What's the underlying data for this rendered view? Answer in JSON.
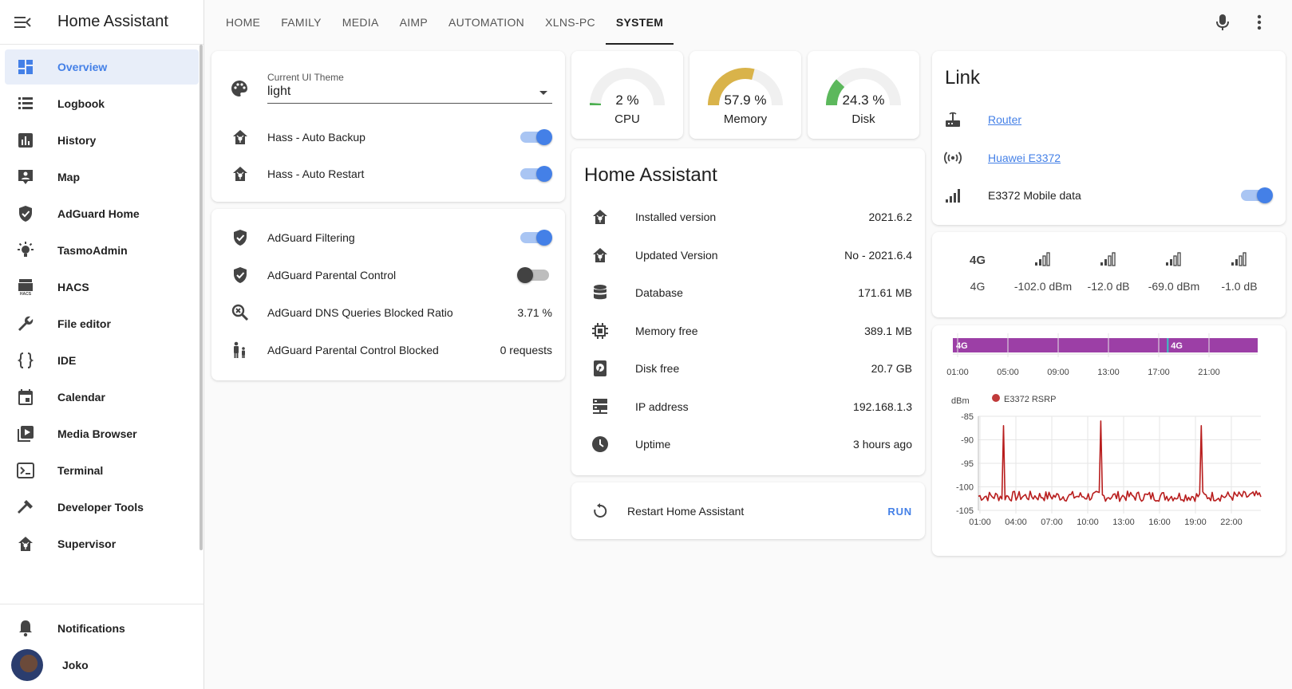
{
  "sidebar": {
    "title": "Home Assistant",
    "items": [
      {
        "label": "Overview",
        "icon": "overview-icon",
        "active": true
      },
      {
        "label": "Logbook",
        "icon": "logbook-icon"
      },
      {
        "label": "History",
        "icon": "history-icon"
      },
      {
        "label": "Map",
        "icon": "map-icon"
      },
      {
        "label": "AdGuard Home",
        "icon": "shield-check-icon"
      },
      {
        "label": "TasmoAdmin",
        "icon": "lightbulb-icon"
      },
      {
        "label": "HACS",
        "icon": "hacs-icon"
      },
      {
        "label": "File editor",
        "icon": "wrench-icon"
      },
      {
        "label": "IDE",
        "icon": "code-braces-icon"
      },
      {
        "label": "Calendar",
        "icon": "calendar-icon"
      },
      {
        "label": "Media Browser",
        "icon": "media-browser-icon"
      },
      {
        "label": "Terminal",
        "icon": "terminal-icon"
      },
      {
        "label": "Developer Tools",
        "icon": "hammer-icon"
      },
      {
        "label": "Supervisor",
        "icon": "supervisor-icon"
      }
    ],
    "notifications_label": "Notifications",
    "user_name": "Joko"
  },
  "topbar": {
    "tabs": [
      "HOME",
      "FAMILY",
      "MEDIA",
      "AIMP",
      "AUTOMATION",
      "XLNS-PC",
      "SYSTEM"
    ],
    "active_tab": "SYSTEM"
  },
  "theme_card": {
    "select_label": "Current UI Theme",
    "select_value": "light",
    "rows": [
      {
        "label": "Hass - Auto Backup",
        "on": true
      },
      {
        "label": "Hass - Auto Restart",
        "on": true
      }
    ]
  },
  "adguard_card": {
    "rows": [
      {
        "label": "AdGuard Filtering",
        "type": "toggle",
        "on": true
      },
      {
        "label": "AdGuard Parental Control",
        "type": "toggle",
        "on": false
      },
      {
        "label": "AdGuard DNS Queries Blocked Ratio",
        "value": "3.71 %"
      },
      {
        "label": "AdGuard Parental Control Blocked",
        "value": "0 requests"
      }
    ]
  },
  "gauges": [
    {
      "name": "CPU",
      "value": "2 %",
      "fraction": 0.02,
      "color": "#4caf50"
    },
    {
      "name": "Memory",
      "value": "57.9 %",
      "fraction": 0.579,
      "color": "#d9b34a"
    },
    {
      "name": "Disk",
      "value": "24.3 %",
      "fraction": 0.243,
      "color": "#5cb85c"
    }
  ],
  "ha_card": {
    "title": "Home Assistant",
    "rows": [
      {
        "label": "Installed version",
        "value": "2021.6.2",
        "icon": "home-assistant-icon"
      },
      {
        "label": "Updated Version",
        "value": "No - 2021.6.4",
        "icon": "home-assistant-icon"
      },
      {
        "label": "Database",
        "value": "171.61 MB",
        "icon": "database-icon"
      },
      {
        "label": "Memory free",
        "value": "389.1 MB",
        "icon": "chip-icon"
      },
      {
        "label": "Disk free",
        "value": "20.7 GB",
        "icon": "harddisk-icon"
      },
      {
        "label": "IP address",
        "value": "192.168.1.3",
        "icon": "server-network-icon"
      },
      {
        "label": "Uptime",
        "value": "3 hours ago",
        "icon": "clock-icon"
      }
    ]
  },
  "restart_card": {
    "label": "Restart Home Assistant",
    "action": "RUN"
  },
  "link_card": {
    "title": "Link",
    "rows": [
      {
        "label": "Router",
        "link": true,
        "icon": "router-icon"
      },
      {
        "label": "Huawei E3372",
        "link": true,
        "icon": "access-point-icon"
      },
      {
        "label": "E3372 Mobile data",
        "toggle": true,
        "on": true,
        "icon": "signal-icon"
      }
    ]
  },
  "signal_card": {
    "items": [
      {
        "icon": "4g-icon",
        "value": "4G"
      },
      {
        "icon": "signal-bars-icon",
        "value": "-102.0 dBm"
      },
      {
        "icon": "signal-bars-icon",
        "value": "-12.0 dB"
      },
      {
        "icon": "signal-bars-icon",
        "value": "-69.0 dBm"
      },
      {
        "icon": "signal-bars-icon",
        "value": "-1.0 dB"
      }
    ]
  },
  "chart_data": [
    {
      "type": "timeline",
      "bars": [
        {
          "label": "4G",
          "color": "#9c3fa6"
        },
        {
          "label": "4G",
          "color": "#9c3fa6"
        }
      ],
      "x_ticks": [
        "01:00",
        "05:00",
        "09:00",
        "13:00",
        "17:00",
        "21:00"
      ]
    },
    {
      "type": "line",
      "ylabel": "dBm",
      "series": [
        {
          "name": "E3372 RSRP",
          "color": "#c03a3a"
        }
      ],
      "ylim": [
        -105,
        -85
      ],
      "y_ticks": [
        "-85",
        "-90",
        "-95",
        "-100",
        "-105"
      ],
      "x_ticks": [
        "01:00",
        "04:00",
        "07:00",
        "10:00",
        "13:00",
        "16:00",
        "19:00",
        "22:00"
      ],
      "baseline": -102,
      "spikes": [
        -87,
        -86,
        -87
      ],
      "grid": true
    }
  ]
}
